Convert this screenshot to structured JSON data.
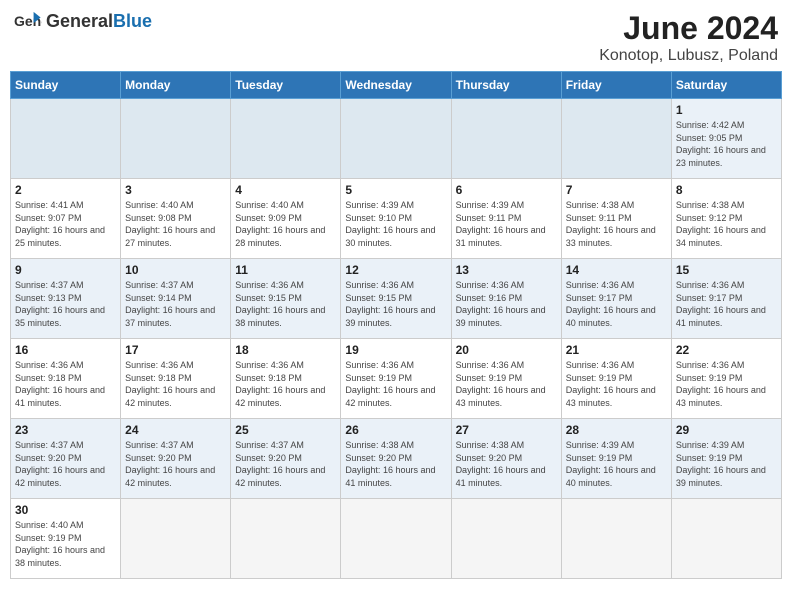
{
  "header": {
    "logo_general": "General",
    "logo_blue": "Blue",
    "title": "June 2024",
    "subtitle": "Konotop, Lubusz, Poland"
  },
  "days_of_week": [
    "Sunday",
    "Monday",
    "Tuesday",
    "Wednesday",
    "Thursday",
    "Friday",
    "Saturday"
  ],
  "weeks": [
    {
      "days": [
        {
          "number": "",
          "info": "",
          "empty": true
        },
        {
          "number": "",
          "info": "",
          "empty": true
        },
        {
          "number": "",
          "info": "",
          "empty": true
        },
        {
          "number": "",
          "info": "",
          "empty": true
        },
        {
          "number": "",
          "info": "",
          "empty": true
        },
        {
          "number": "",
          "info": "",
          "empty": true
        },
        {
          "number": "1",
          "info": "Sunrise: 4:42 AM\nSunset: 9:05 PM\nDaylight: 16 hours\nand 23 minutes.",
          "empty": false
        }
      ]
    },
    {
      "days": [
        {
          "number": "2",
          "info": "Sunrise: 4:41 AM\nSunset: 9:07 PM\nDaylight: 16 hours\nand 25 minutes.",
          "empty": false
        },
        {
          "number": "3",
          "info": "Sunrise: 4:40 AM\nSunset: 9:08 PM\nDaylight: 16 hours\nand 27 minutes.",
          "empty": false
        },
        {
          "number": "4",
          "info": "Sunrise: 4:40 AM\nSunset: 9:09 PM\nDaylight: 16 hours\nand 28 minutes.",
          "empty": false
        },
        {
          "number": "5",
          "info": "Sunrise: 4:39 AM\nSunset: 9:10 PM\nDaylight: 16 hours\nand 30 minutes.",
          "empty": false
        },
        {
          "number": "6",
          "info": "Sunrise: 4:39 AM\nSunset: 9:11 PM\nDaylight: 16 hours\nand 31 minutes.",
          "empty": false
        },
        {
          "number": "7",
          "info": "Sunrise: 4:38 AM\nSunset: 9:11 PM\nDaylight: 16 hours\nand 33 minutes.",
          "empty": false
        },
        {
          "number": "8",
          "info": "Sunrise: 4:38 AM\nSunset: 9:12 PM\nDaylight: 16 hours\nand 34 minutes.",
          "empty": false
        }
      ]
    },
    {
      "days": [
        {
          "number": "9",
          "info": "Sunrise: 4:37 AM\nSunset: 9:13 PM\nDaylight: 16 hours\nand 35 minutes.",
          "empty": false
        },
        {
          "number": "10",
          "info": "Sunrise: 4:37 AM\nSunset: 9:14 PM\nDaylight: 16 hours\nand 37 minutes.",
          "empty": false
        },
        {
          "number": "11",
          "info": "Sunrise: 4:36 AM\nSunset: 9:15 PM\nDaylight: 16 hours\nand 38 minutes.",
          "empty": false
        },
        {
          "number": "12",
          "info": "Sunrise: 4:36 AM\nSunset: 9:15 PM\nDaylight: 16 hours\nand 39 minutes.",
          "empty": false
        },
        {
          "number": "13",
          "info": "Sunrise: 4:36 AM\nSunset: 9:16 PM\nDaylight: 16 hours\nand 39 minutes.",
          "empty": false
        },
        {
          "number": "14",
          "info": "Sunrise: 4:36 AM\nSunset: 9:17 PM\nDaylight: 16 hours\nand 40 minutes.",
          "empty": false
        },
        {
          "number": "15",
          "info": "Sunrise: 4:36 AM\nSunset: 9:17 PM\nDaylight: 16 hours\nand 41 minutes.",
          "empty": false
        }
      ]
    },
    {
      "days": [
        {
          "number": "16",
          "info": "Sunrise: 4:36 AM\nSunset: 9:18 PM\nDaylight: 16 hours\nand 41 minutes.",
          "empty": false
        },
        {
          "number": "17",
          "info": "Sunrise: 4:36 AM\nSunset: 9:18 PM\nDaylight: 16 hours\nand 42 minutes.",
          "empty": false
        },
        {
          "number": "18",
          "info": "Sunrise: 4:36 AM\nSunset: 9:18 PM\nDaylight: 16 hours\nand 42 minutes.",
          "empty": false
        },
        {
          "number": "19",
          "info": "Sunrise: 4:36 AM\nSunset: 9:19 PM\nDaylight: 16 hours\nand 42 minutes.",
          "empty": false
        },
        {
          "number": "20",
          "info": "Sunrise: 4:36 AM\nSunset: 9:19 PM\nDaylight: 16 hours\nand 43 minutes.",
          "empty": false
        },
        {
          "number": "21",
          "info": "Sunrise: 4:36 AM\nSunset: 9:19 PM\nDaylight: 16 hours\nand 43 minutes.",
          "empty": false
        },
        {
          "number": "22",
          "info": "Sunrise: 4:36 AM\nSunset: 9:19 PM\nDaylight: 16 hours\nand 43 minutes.",
          "empty": false
        }
      ]
    },
    {
      "days": [
        {
          "number": "23",
          "info": "Sunrise: 4:37 AM\nSunset: 9:20 PM\nDaylight: 16 hours\nand 42 minutes.",
          "empty": false
        },
        {
          "number": "24",
          "info": "Sunrise: 4:37 AM\nSunset: 9:20 PM\nDaylight: 16 hours\nand 42 minutes.",
          "empty": false
        },
        {
          "number": "25",
          "info": "Sunrise: 4:37 AM\nSunset: 9:20 PM\nDaylight: 16 hours\nand 42 minutes.",
          "empty": false
        },
        {
          "number": "26",
          "info": "Sunrise: 4:38 AM\nSunset: 9:20 PM\nDaylight: 16 hours\nand 41 minutes.",
          "empty": false
        },
        {
          "number": "27",
          "info": "Sunrise: 4:38 AM\nSunset: 9:20 PM\nDaylight: 16 hours\nand 41 minutes.",
          "empty": false
        },
        {
          "number": "28",
          "info": "Sunrise: 4:39 AM\nSunset: 9:19 PM\nDaylight: 16 hours\nand 40 minutes.",
          "empty": false
        },
        {
          "number": "29",
          "info": "Sunrise: 4:39 AM\nSunset: 9:19 PM\nDaylight: 16 hours\nand 39 minutes.",
          "empty": false
        }
      ]
    },
    {
      "days": [
        {
          "number": "30",
          "info": "Sunrise: 4:40 AM\nSunset: 9:19 PM\nDaylight: 16 hours\nand 38 minutes.",
          "empty": false
        },
        {
          "number": "",
          "info": "",
          "empty": true
        },
        {
          "number": "",
          "info": "",
          "empty": true
        },
        {
          "number": "",
          "info": "",
          "empty": true
        },
        {
          "number": "",
          "info": "",
          "empty": true
        },
        {
          "number": "",
          "info": "",
          "empty": true
        },
        {
          "number": "",
          "info": "",
          "empty": true
        }
      ]
    }
  ]
}
